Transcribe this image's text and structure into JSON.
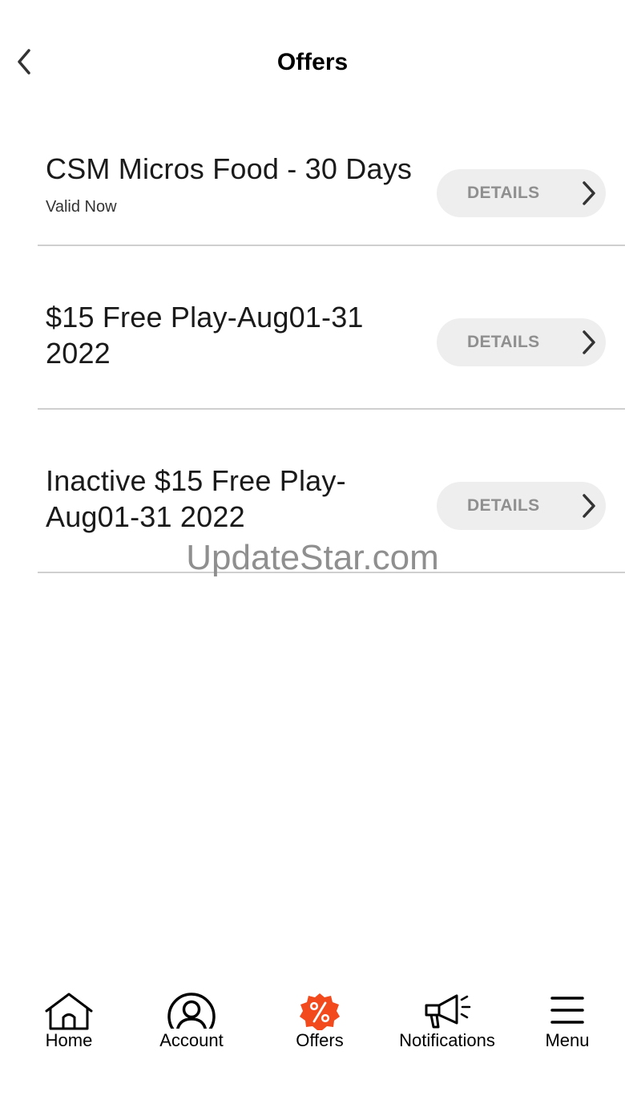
{
  "header": {
    "title": "Offers",
    "back_icon": "chevron-left-icon"
  },
  "offers": [
    {
      "title": "CSM Micros Food - 30 Days",
      "status": "Valid Now",
      "details_label": "DETAILS"
    },
    {
      "title": "$15 Free Play-Aug01-31 2022",
      "status": "",
      "details_label": "DETAILS"
    },
    {
      "title": "Inactive $15 Free Play-Aug01-31 2022",
      "status": "",
      "details_label": "DETAILS"
    }
  ],
  "watermark": "UpdateStar.com",
  "tabbar": {
    "active": "offers",
    "accent_color": "#f24a1d",
    "items": [
      {
        "id": "home",
        "label": "Home",
        "icon": "home-icon"
      },
      {
        "id": "account",
        "label": "Account",
        "icon": "account-icon"
      },
      {
        "id": "offers",
        "label": "Offers",
        "icon": "percent-badge-icon"
      },
      {
        "id": "notifications",
        "label": "Notifications",
        "icon": "megaphone-icon"
      },
      {
        "id": "menu",
        "label": "Menu",
        "icon": "hamburger-menu-icon"
      }
    ]
  }
}
